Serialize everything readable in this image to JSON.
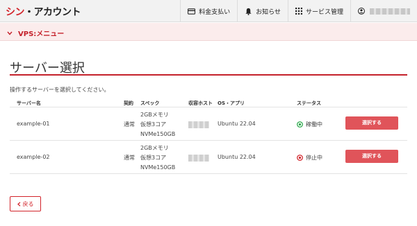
{
  "header": {
    "logo_red": "シン",
    "logo_dark": "・アカウント",
    "nav": {
      "billing": "料金支払い",
      "notices": "お知らせ",
      "services": "サービス管理",
      "user_name": "■■■■■■ ■■■"
    }
  },
  "breadcrumb": {
    "label": "VPS:メニュー"
  },
  "page": {
    "title": "サーバー選択",
    "instruction": "操作するサーバーを選択してください。"
  },
  "table": {
    "columns": [
      "サーバー名",
      "契約",
      "スペック",
      "収容ホスト",
      "OS・アプリ",
      "ステータス"
    ],
    "rows": [
      {
        "name": "example-01",
        "contract": "通常",
        "spec": [
          "2GBメモリ",
          "仮想3コア",
          "NVMe150GB"
        ],
        "os": "Ubuntu 22.04",
        "status": "稼働中",
        "status_color": "#2aa84a",
        "action": "選択する"
      },
      {
        "name": "example-02",
        "contract": "通常",
        "spec": [
          "2GBメモリ",
          "仮想3コア",
          "NVMe150GB"
        ],
        "os": "Ubuntu 22.04",
        "status": "停止中",
        "status_color": "#d2232a",
        "action": "選択する"
      }
    ]
  },
  "back_button": {
    "label": "戻る"
  },
  "colors": {
    "accent": "#d2232a",
    "button": "#e0545a",
    "crumb_bg": "#fbecec"
  }
}
